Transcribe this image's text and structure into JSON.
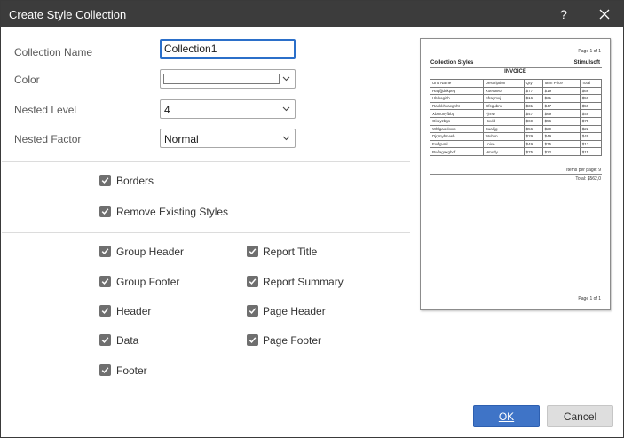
{
  "window": {
    "title": "Create Style Collection",
    "help_label": "?",
    "close_icon": "close-icon"
  },
  "form": {
    "collection_name_label": "Collection Name",
    "collection_name_value": "Collection1",
    "color_label": "Color",
    "color_value": "#ffffff",
    "nested_level_label": "Nested Level",
    "nested_level_value": "4",
    "nested_factor_label": "Nested Factor",
    "nested_factor_value": "Normal"
  },
  "options": {
    "borders": {
      "label": "Borders",
      "checked": true
    },
    "remove_existing": {
      "label": "Remove Existing Styles",
      "checked": true
    }
  },
  "sections": {
    "group_header": {
      "label": "Group Header",
      "checked": true
    },
    "group_footer": {
      "label": "Group Footer",
      "checked": true
    },
    "header": {
      "label": "Header",
      "checked": true
    },
    "data": {
      "label": "Data",
      "checked": true
    },
    "footer": {
      "label": "Footer",
      "checked": true
    },
    "report_title": {
      "label": "Report Title",
      "checked": true
    },
    "report_summary": {
      "label": "Report Summary",
      "checked": true
    },
    "page_header": {
      "label": "Page Header",
      "checked": true
    },
    "page_footer": {
      "label": "Page Footer",
      "checked": true
    }
  },
  "preview": {
    "page_top": "Page 1 of 1",
    "collection_title": "Collection Styles",
    "brand": "Stimulsoft",
    "invoice": "INVOICE",
    "columns": [
      "Unit Name",
      "Description",
      "Qty",
      "Item Price",
      "Total"
    ],
    "rows": [
      [
        "Hagfjjdnkpeg",
        "Xoevaeof",
        "$77",
        "$19",
        "$66"
      ],
      [
        "Hbikogizh",
        "Kfraymxj",
        "$16",
        "$31",
        "$59"
      ],
      [
        "Rakkkhvacgnht",
        "Gfcgubnv",
        "$31",
        "$47",
        "$59"
      ],
      [
        "Xbmunyfbbg",
        "Fjrnw",
        "$47",
        "$69",
        "$49"
      ],
      [
        "Gkayzbgs",
        "Hxxld",
        "$69",
        "$56",
        "$75"
      ],
      [
        "Wblgaokkxxs",
        "Buakjg",
        "$56",
        "$29",
        "$22"
      ],
      [
        "Djrjmyhsvwh",
        "Wuhvn",
        "$29",
        "$49",
        "$49"
      ],
      [
        "Furfgvml",
        "Lnixe",
        "$49",
        "$75",
        "$13"
      ],
      [
        "Rwfagaxgbof",
        "Hmxdy",
        "$75",
        "$22",
        "$11"
      ]
    ],
    "items_per_page": "Items per page: 9",
    "total": "Total: $562,0",
    "page_bottom": "Page 1 of 1"
  },
  "buttons": {
    "ok_label": "OK",
    "cancel_label": "Cancel"
  }
}
